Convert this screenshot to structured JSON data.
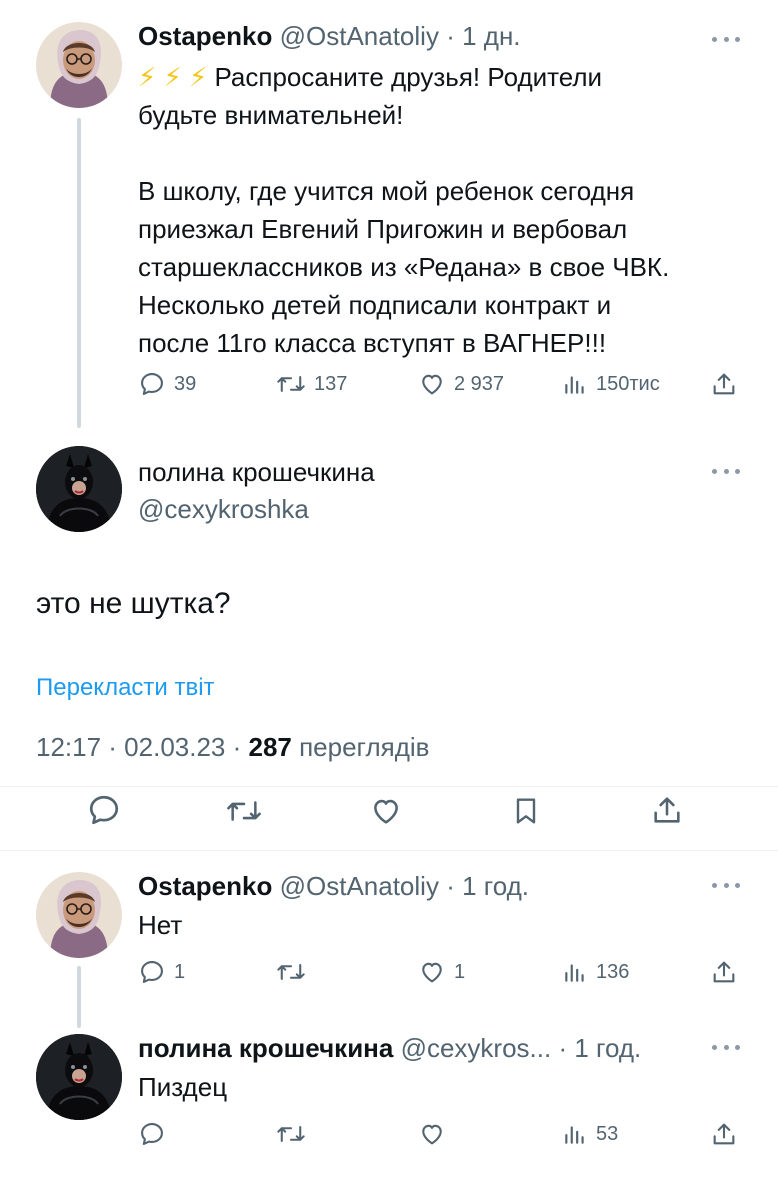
{
  "tweet1": {
    "name": "Ostapenko",
    "handle": "@OstAnatoliy",
    "sep": "·",
    "time": "1 дн.",
    "emoji": "⚡ ⚡ ⚡",
    "line1": "Распросаните друзья! Родители",
    "line2": "будьте внимательней!",
    "line3": "В школу, где учится мой ребенок сегодня",
    "line4": "приезжал Евгений Пригожин и вербовал",
    "line5": "старшеклассников из «Редана» в свое ЧВК.",
    "line6": "Несколько детей подписали контракт и",
    "line7": "после 11го класса вступят в ВАГНЕР!!!",
    "replies": "39",
    "retweets": "137",
    "likes": "2 937",
    "views": "150тис"
  },
  "main": {
    "name": "полина крошечкина",
    "handle": "@cexykroshka",
    "text": "это не шутка?",
    "translate": "Перекласти твіт",
    "time": "12:17 · 02.03.23 · ",
    "views_count": "287",
    "views_label": " переглядів"
  },
  "reply1": {
    "name": "Ostapenko",
    "handle": "@OstAnatoliy",
    "sep": "·",
    "time": "1 год.",
    "text": "Нет",
    "replies": "1",
    "likes": "1",
    "views": "136"
  },
  "reply2": {
    "name": "полина крошечкина",
    "handle": "@cexykros...",
    "sep": "·",
    "time": "1 год.",
    "text": "Пиздец",
    "views": "53"
  },
  "colors": {
    "link": "#1d9bf0",
    "muted": "#536471",
    "divider": "#eff3f4",
    "thread": "#cfd9de"
  },
  "icons": [
    "reply-icon",
    "retweet-icon",
    "like-icon",
    "views-icon",
    "share-icon",
    "bookmark-icon",
    "more-icon",
    "bolt-icon"
  ]
}
